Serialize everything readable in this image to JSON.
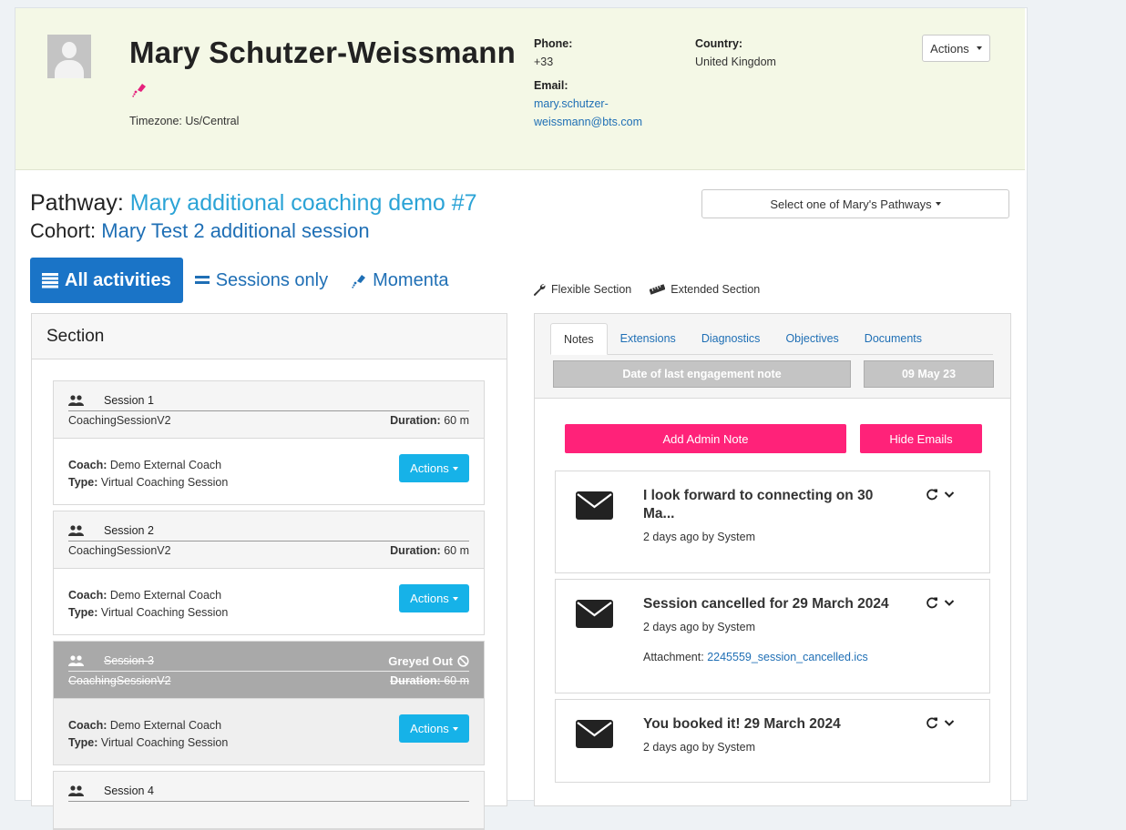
{
  "header": {
    "name": "Mary Schutzer-Weissmann",
    "timezone": "Timezone: Us/Central",
    "phone_label": "Phone:",
    "phone": "+33",
    "email_label": "Email:",
    "email_line1": "mary.schutzer-",
    "email_line2": "weissmann@bts.com",
    "country_label": "Country:",
    "country": "United Kingdom",
    "actions_label": "Actions"
  },
  "pathway": {
    "label": "Pathway:",
    "value": "Mary additional coaching demo #7",
    "cohort_label": "Cohort:",
    "cohort_value": "Mary Test 2 additional session",
    "select_label": "Select one of Mary's Pathways"
  },
  "view_tabs": [
    {
      "label": "All activities",
      "icon": "list-icon"
    },
    {
      "label": "Sessions only",
      "icon": "equals-icon"
    },
    {
      "label": "Momenta",
      "icon": "momenta-icon"
    }
  ],
  "legend": {
    "flexible": "Flexible Section",
    "extended": "Extended Section"
  },
  "section": {
    "title": "Section",
    "sessions": [
      {
        "name": "Session 1",
        "type_code": "CoachingSessionV2",
        "duration_label": "Duration:",
        "duration": "60 m",
        "coach_label": "Coach:",
        "coach": "Demo External Coach",
        "type_label": "Type:",
        "type": "Virtual Coaching Session",
        "actions": "Actions",
        "status": ""
      },
      {
        "name": "Session 2",
        "type_code": "CoachingSessionV2",
        "duration_label": "Duration:",
        "duration": "60 m",
        "coach_label": "Coach:",
        "coach": "Demo External Coach",
        "type_label": "Type:",
        "type": "Virtual Coaching Session",
        "actions": "Actions",
        "status": ""
      },
      {
        "name": "Session 3",
        "type_code": "CoachingSessionV2",
        "duration_label": "Duration:",
        "duration": "60 m",
        "coach_label": "Coach:",
        "coach": "Demo External Coach",
        "type_label": "Type:",
        "type": "Virtual Coaching Session",
        "actions": "Actions",
        "status": "Greyed Out"
      },
      {
        "name": "Session 4"
      }
    ]
  },
  "notes_panel": {
    "tabs": [
      "Notes",
      "Extensions",
      "Diagnostics",
      "Objectives",
      "Documents"
    ],
    "engagement_label": "Date of last engagement note",
    "engagement_date": "09 May 23",
    "add_note": "Add Admin Note",
    "hide_emails": "Hide Emails",
    "notes": [
      {
        "title": "I look forward to connecting on 30 Ma...",
        "meta": "2 days ago by System",
        "attachment_label": "",
        "attachment": ""
      },
      {
        "title": "Session cancelled for 29 March 2024",
        "meta": "2 days ago by System",
        "attachment_label": "Attachment:",
        "attachment": "2245559_session_cancelled.ics"
      },
      {
        "title": "You booked it! 29 March 2024",
        "meta": "2 days ago by System",
        "attachment_label": "",
        "attachment": ""
      }
    ]
  },
  "colors": {
    "header_bg": "#f4f8e6",
    "primary": "#1a74c7",
    "link": "#1f6fb5",
    "pathway_link": "#2ba3d6",
    "action_button": "#16b2e8",
    "pink_button": "#ff2279"
  }
}
